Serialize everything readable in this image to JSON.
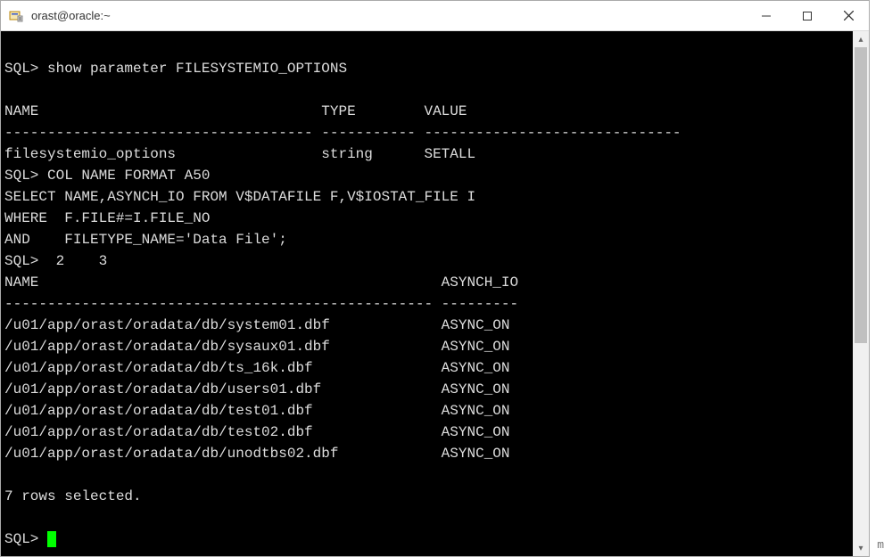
{
  "window": {
    "title": "orast@oracle:~"
  },
  "terminal": {
    "prompt": "SQL>",
    "cmd_show": "show parameter FILESYSTEMIO_OPTIONS",
    "hdr1": {
      "name": "NAME",
      "type": "TYPE",
      "value": "VALUE"
    },
    "sep1": "------------------------------------ ----------- ------------------------------",
    "row1": {
      "name": "filesystemio_options",
      "type": "string",
      "value": "SETALL"
    },
    "cmd_col": "COL NAME FORMAT A50",
    "cmd_sel1": "SELECT NAME,ASYNCH_IO FROM V$DATAFILE F,V$IOSTAT_FILE I",
    "cmd_sel2": "WHERE  F.FILE#=I.FILE_NO",
    "cmd_sel3": "AND    FILETYPE_NAME='Data File';",
    "cont": "  2    3",
    "hdr2": {
      "name": "NAME",
      "async": "ASYNCH_IO"
    },
    "sep2": "-------------------------------------------------- ---------",
    "files": [
      {
        "name": "/u01/app/orast/oradata/db/system01.dbf",
        "async": "ASYNC_ON"
      },
      {
        "name": "/u01/app/orast/oradata/db/sysaux01.dbf",
        "async": "ASYNC_ON"
      },
      {
        "name": "/u01/app/orast/oradata/db/ts_16k.dbf",
        "async": "ASYNC_ON"
      },
      {
        "name": "/u01/app/orast/oradata/db/users01.dbf",
        "async": "ASYNC_ON"
      },
      {
        "name": "/u01/app/orast/oradata/db/test01.dbf",
        "async": "ASYNC_ON"
      },
      {
        "name": "/u01/app/orast/oradata/db/test02.dbf",
        "async": "ASYNC_ON"
      },
      {
        "name": "/u01/app/orast/oradata/db/unodtbs02.dbf",
        "async": "ASYNC_ON"
      }
    ],
    "summary": "7 rows selected."
  },
  "side_char": "m"
}
